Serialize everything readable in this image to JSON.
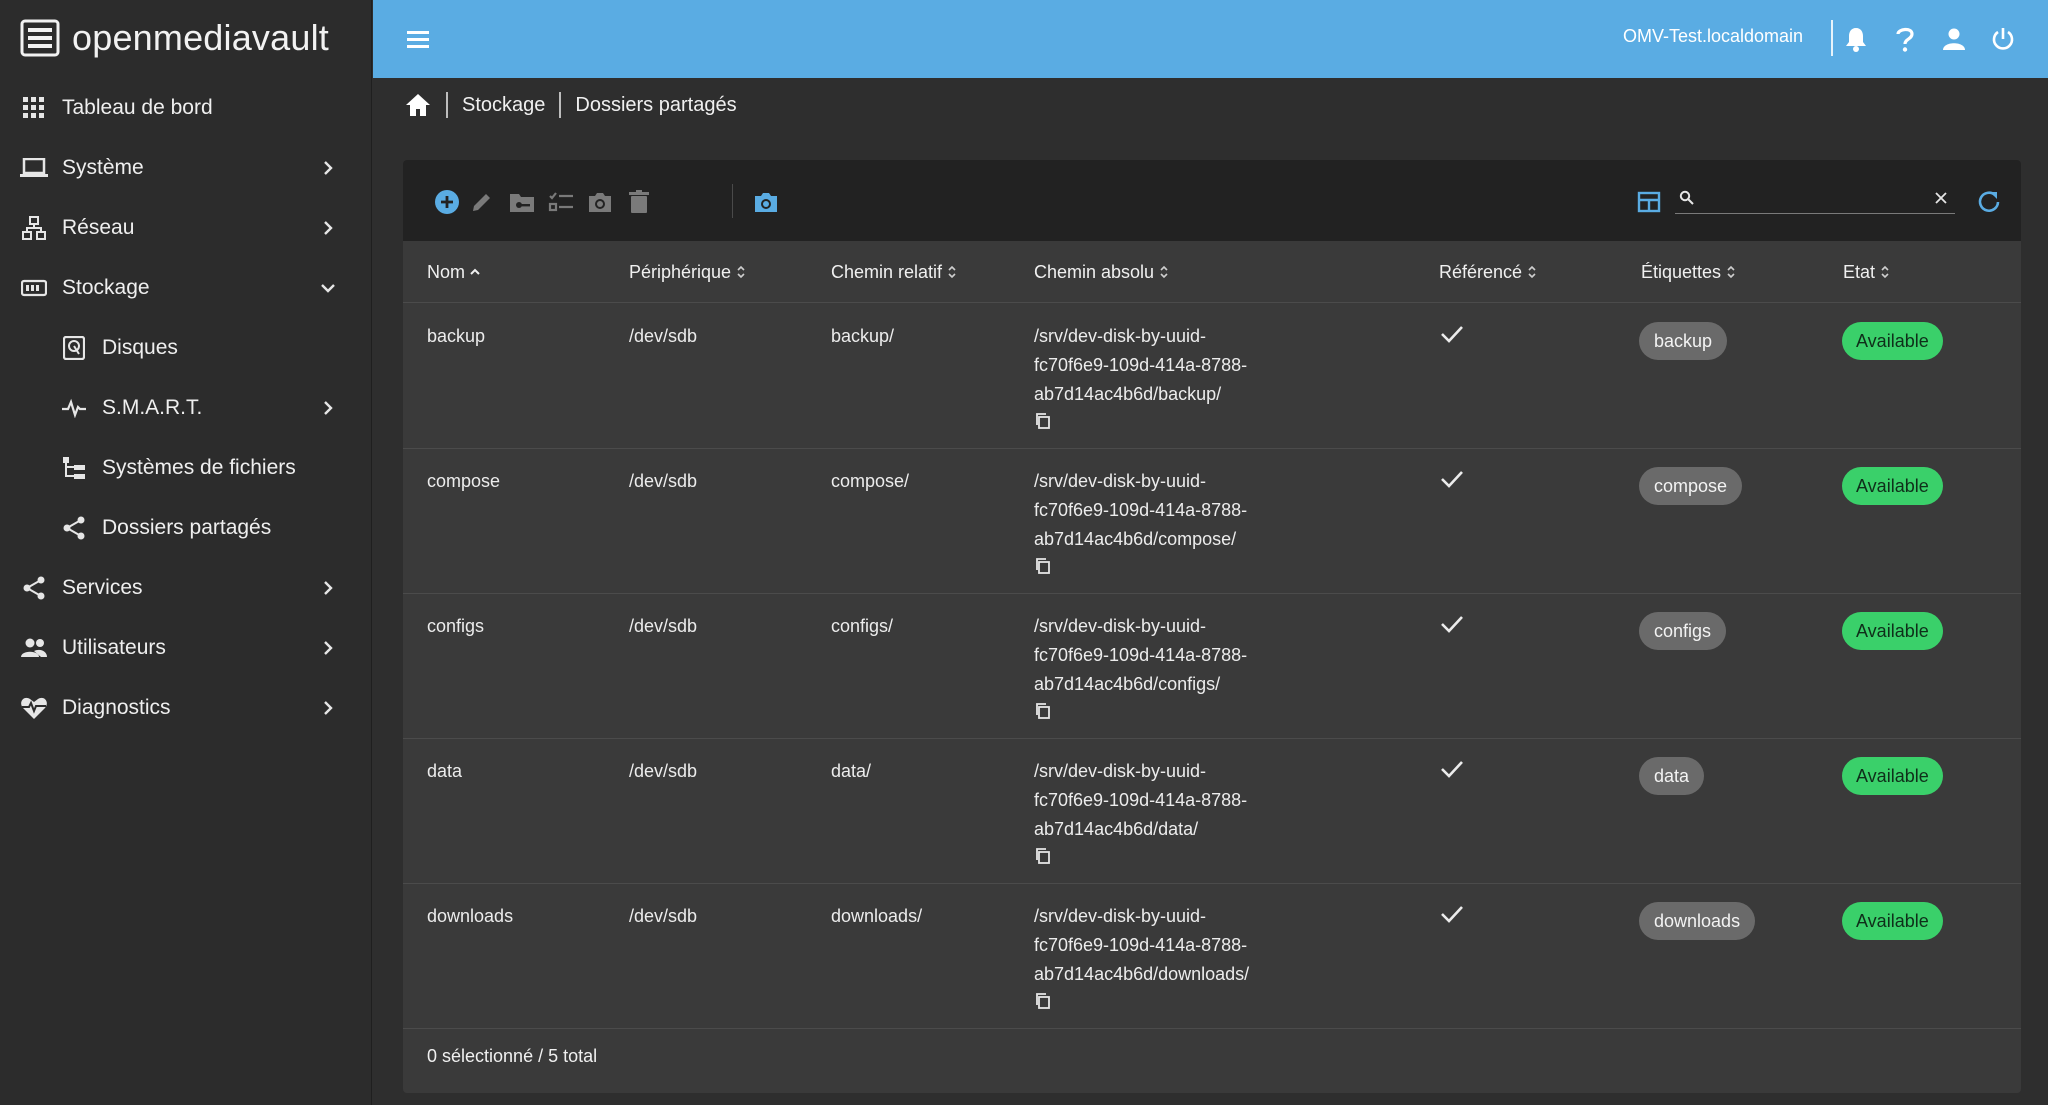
{
  "app": {
    "brand": "openmediavault"
  },
  "sidebar": {
    "items": [
      {
        "label": "Tableau de bord",
        "icon": "grid-icon"
      },
      {
        "label": "Système",
        "icon": "laptop-icon"
      },
      {
        "label": "Réseau",
        "icon": "network-icon"
      },
      {
        "label": "Stockage",
        "icon": "storage-icon",
        "expanded": true
      },
      {
        "label": "Disques",
        "icon": "disk-icon"
      },
      {
        "label": "S.M.A.R.T.",
        "icon": "pulse-icon"
      },
      {
        "label": "Systèmes de fichiers",
        "icon": "file-tree-icon"
      },
      {
        "label": "Dossiers partagés",
        "icon": "share-icon"
      },
      {
        "label": "Services",
        "icon": "share-icon"
      },
      {
        "label": "Utilisateurs",
        "icon": "users-icon"
      },
      {
        "label": "Diagnostics",
        "icon": "heart-pulse-icon"
      }
    ]
  },
  "topbar": {
    "hostname": "OMV-Test.localdomain",
    "color": "#5aace3"
  },
  "breadcrumb": {
    "items": [
      "Stockage",
      "Dossiers partagés"
    ]
  },
  "search": {
    "value": ""
  },
  "table": {
    "columns": [
      "Nom",
      "Périphérique",
      "Chemin relatif",
      "Chemin absolu",
      "Référencé",
      "Étiquettes",
      "Etat"
    ],
    "sort_column": "Nom",
    "sort_direction": "asc",
    "rows": [
      {
        "name": "backup",
        "device": "/dev/sdb",
        "relpath": "backup/",
        "abspath": [
          "/srv/dev-disk-by-uuid-",
          "fc70f6e9-109d-414a-8788-",
          "ab7d14ac4b6d/backup/"
        ],
        "referenced": true,
        "tag": "backup",
        "state": "Available"
      },
      {
        "name": "compose",
        "device": "/dev/sdb",
        "relpath": "compose/",
        "abspath": [
          "/srv/dev-disk-by-uuid-",
          "fc70f6e9-109d-414a-8788-",
          "ab7d14ac4b6d/compose/"
        ],
        "referenced": true,
        "tag": "compose",
        "state": "Available"
      },
      {
        "name": "configs",
        "device": "/dev/sdb",
        "relpath": "configs/",
        "abspath": [
          "/srv/dev-disk-by-uuid-",
          "fc70f6e9-109d-414a-8788-",
          "ab7d14ac4b6d/configs/"
        ],
        "referenced": true,
        "tag": "configs",
        "state": "Available"
      },
      {
        "name": "data",
        "device": "/dev/sdb",
        "relpath": "data/",
        "abspath": [
          "/srv/dev-disk-by-uuid-",
          "fc70f6e9-109d-414a-8788-",
          "ab7d14ac4b6d/data/"
        ],
        "referenced": true,
        "tag": "data",
        "state": "Available"
      },
      {
        "name": "downloads",
        "device": "/dev/sdb",
        "relpath": "downloads/",
        "abspath": [
          "/srv/dev-disk-by-uuid-",
          "fc70f6e9-109d-414a-8788-",
          "ab7d14ac4b6d/downloads/"
        ],
        "referenced": true,
        "tag": "downloads",
        "state": "Available"
      }
    ]
  },
  "footer": {
    "selection": "0 sélectionné / 5 total"
  },
  "colors": {
    "accent": "#5aace3",
    "available": "#3ad06a",
    "chip": "#6a6a6a"
  }
}
